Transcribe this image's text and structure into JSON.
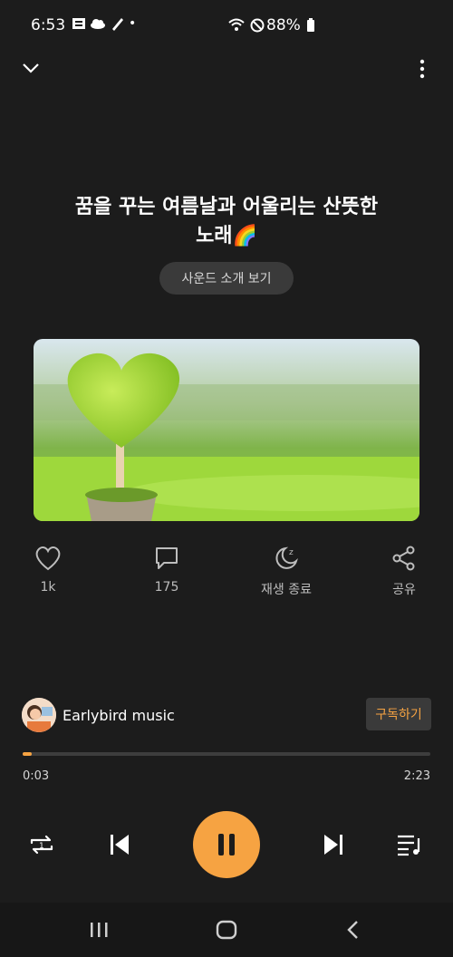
{
  "status_bar": {
    "time": "6:53",
    "battery": "88%"
  },
  "track": {
    "title_line1": "꿈을 꾸는 여름날과 어울리는 산뜻한",
    "title_line2": "노래🌈"
  },
  "intro_button": "사운드 소개 보기",
  "actions": {
    "like_count": "1k",
    "comment_count": "175",
    "sleep_label": "재생 종료",
    "share_label": "공유"
  },
  "channel": {
    "name": "Earlybird music",
    "subscribe_label": "구독하기"
  },
  "playback": {
    "current_time": "0:03",
    "duration": "2:23",
    "progress_fraction": 0.022
  },
  "colors": {
    "accent": "#f6a342",
    "background": "#1c1c1c"
  }
}
